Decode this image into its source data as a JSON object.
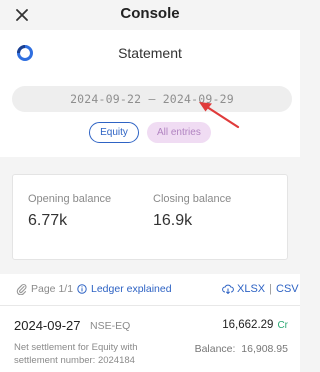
{
  "topbar": {
    "title": "Console",
    "close_icon": "close-icon"
  },
  "header": {
    "title": "Statement",
    "logo_icon": "app-logo-icon"
  },
  "date_range": {
    "from": "2024-09-22",
    "separator": "—",
    "to": "2024-09-29"
  },
  "annotation": {
    "icon": "red-arrow-icon",
    "color": "#e03b3b"
  },
  "filters": [
    {
      "label": "Equity",
      "selected": true
    },
    {
      "label": "All entries",
      "selected": false
    }
  ],
  "balances": {
    "opening_label": "Opening balance",
    "opening_value": "6.77k",
    "closing_label": "Closing balance",
    "closing_value": "16.9k"
  },
  "toolbar": {
    "page_label": "Page 1/1",
    "ledger_label": "Ledger explained",
    "xlsx_label": "XLSX",
    "separator": "|",
    "csv_label": "CSV"
  },
  "entries": [
    {
      "date": "2024-09-27",
      "segment": "NSE-EQ",
      "amount": "16,662.29",
      "type": "Cr",
      "description": "Net settlement for Equity with settlement number: 2024184",
      "balance": "Balance:  16,908.95"
    }
  ],
  "colors": {
    "accent": "#2e63c4",
    "credit": "#2aa872",
    "chip_pink": "#f0dcf3"
  }
}
